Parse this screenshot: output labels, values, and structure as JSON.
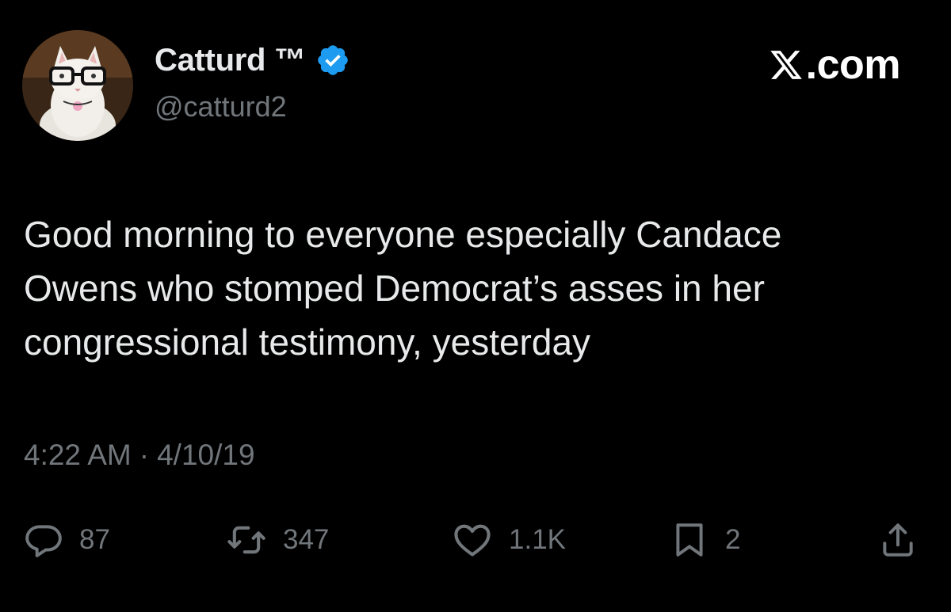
{
  "author": {
    "display_name": "Catturd ™",
    "handle": "@catturd2",
    "verified": true,
    "avatar_icon": "cat-with-glasses-avatar",
    "verified_color": "#1d9bf0"
  },
  "brand": {
    "label": ".com",
    "logo_icon": "x-logo-icon"
  },
  "tweet": {
    "text": "Good morning to everyone especially Candace\nOwens who stomped Democrat’s asses in her\ncongressional testimony, yesterday",
    "time": "4:22 AM",
    "separator": "·",
    "date": "4/10/19"
  },
  "actions": {
    "reply": {
      "icon": "reply-icon",
      "count": "87"
    },
    "retweet": {
      "icon": "retweet-icon",
      "count": "347"
    },
    "like": {
      "icon": "heart-icon",
      "count": "1.1K"
    },
    "bookmark": {
      "icon": "bookmark-icon",
      "count": "2"
    },
    "share": {
      "icon": "share-icon"
    }
  },
  "colors": {
    "background": "#000000",
    "primary_text": "#e7e9ea",
    "secondary_text": "#71767b",
    "accent": "#1d9bf0"
  }
}
